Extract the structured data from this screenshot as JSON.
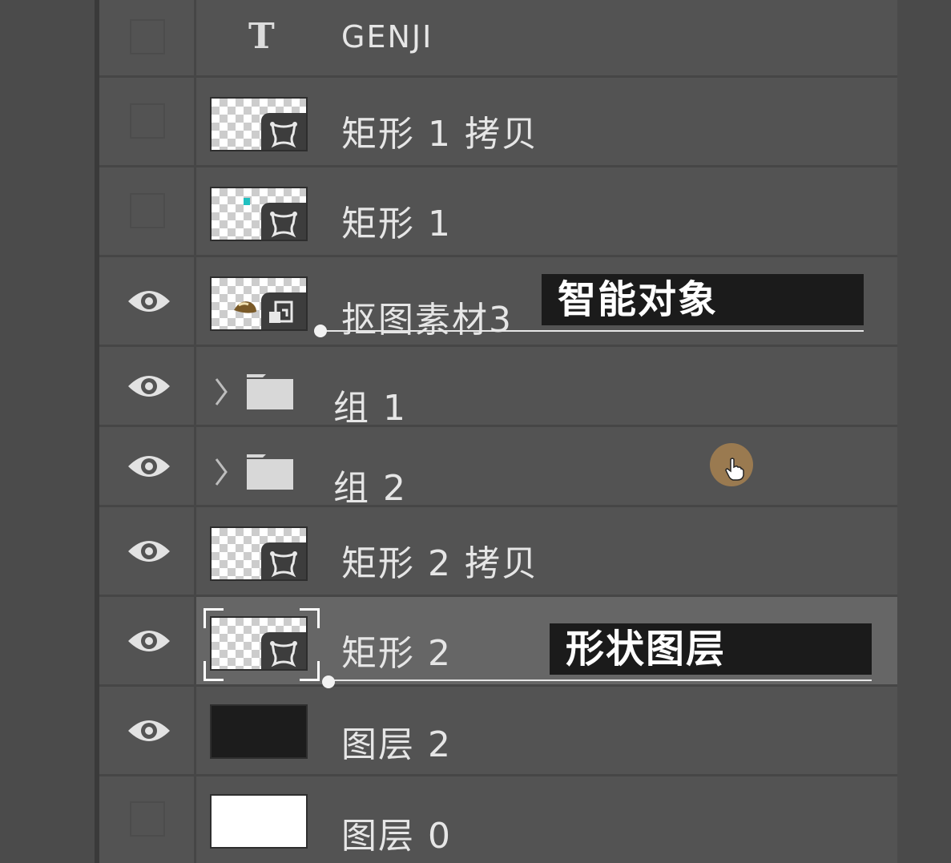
{
  "layers_panel": {
    "layers": [
      {
        "name": "GENJI",
        "kind": "text",
        "visible": false,
        "type_icon": "T"
      },
      {
        "name": "矩形 1 拷贝",
        "kind": "shape",
        "visible": false
      },
      {
        "name": "矩形 1",
        "kind": "shape",
        "visible": false
      },
      {
        "name": "抠图素材3",
        "kind": "smart-object",
        "visible": true
      },
      {
        "name": "组 1",
        "kind": "group",
        "visible": true,
        "expanded": false
      },
      {
        "name": "组 2",
        "kind": "group",
        "visible": true,
        "expanded": false
      },
      {
        "name": "矩形 2 拷贝",
        "kind": "shape",
        "visible": true
      },
      {
        "name": "矩形 2",
        "kind": "shape",
        "visible": true,
        "selected": true
      },
      {
        "name": "图层 2",
        "kind": "pixel",
        "visible": true,
        "fill": "#1c1c1c"
      },
      {
        "name": "图层 0",
        "kind": "pixel",
        "visible": false,
        "fill": "#ffffff"
      }
    ]
  },
  "annotations": {
    "smart_object_label": "智能对象",
    "shape_layer_label": "形状图层"
  },
  "colors": {
    "panel_bg": "#535353",
    "selected_row_bg": "#666666",
    "callout_bg": "#1b1b1b",
    "cursor_highlight": "#9a7a50"
  }
}
